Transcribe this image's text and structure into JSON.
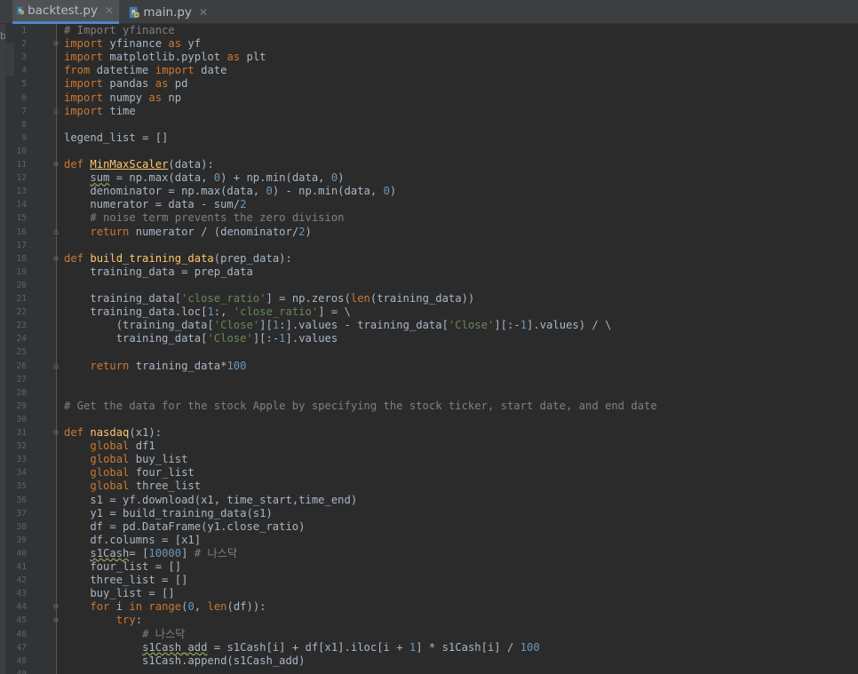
{
  "tabs": [
    {
      "label": "backtest.py",
      "active": true
    },
    {
      "label": "main.py",
      "active": false
    }
  ],
  "left_edge_glyph": "b",
  "icon": "python-file-icon",
  "colors": {
    "background": "#2b2b2b",
    "keyword": "#cc7832",
    "comment": "#808080",
    "string": "#6a8759",
    "number": "#6897bb",
    "function": "#ffc66d",
    "text": "#a9b7c6",
    "tab_accent": "#4a88c7"
  },
  "editor": {
    "lines": [
      {
        "n": "1",
        "fold": "",
        "t": [
          [
            "cm",
            "# Import yfinance"
          ]
        ]
      },
      {
        "n": "2",
        "fold": "open",
        "t": [
          [
            "kw",
            "import"
          ],
          [
            "",
            " yfinance "
          ],
          [
            "kw",
            "as"
          ],
          [
            "",
            " yf"
          ]
        ]
      },
      {
        "n": "3",
        "fold": "",
        "t": [
          [
            "kw",
            "import"
          ],
          [
            "",
            " matplotlib.pyplot "
          ],
          [
            "kw",
            "as"
          ],
          [
            "",
            " plt"
          ]
        ]
      },
      {
        "n": "4",
        "fold": "",
        "t": [
          [
            "kw",
            "from"
          ],
          [
            "",
            " datetime "
          ],
          [
            "kw",
            "import"
          ],
          [
            "",
            " date"
          ]
        ]
      },
      {
        "n": "5",
        "fold": "",
        "t": [
          [
            "kw",
            "import"
          ],
          [
            "",
            " pandas "
          ],
          [
            "kw",
            "as"
          ],
          [
            "",
            " pd"
          ]
        ]
      },
      {
        "n": "6",
        "fold": "",
        "t": [
          [
            "kw",
            "import"
          ],
          [
            "",
            " numpy "
          ],
          [
            "kw",
            "as"
          ],
          [
            "",
            " np"
          ]
        ]
      },
      {
        "n": "7",
        "fold": "close",
        "t": [
          [
            "kw",
            "import"
          ],
          [
            "",
            " time"
          ]
        ]
      },
      {
        "n": "8",
        "fold": "",
        "t": []
      },
      {
        "n": "9",
        "fold": "",
        "t": [
          [
            "",
            "legend_list = []"
          ]
        ]
      },
      {
        "n": "10",
        "fold": "",
        "t": []
      },
      {
        "n": "11",
        "fold": "open",
        "t": [
          [
            "kw",
            "def "
          ],
          [
            "fnu",
            "MinMaxScaler"
          ],
          [
            "",
            "(data):"
          ]
        ]
      },
      {
        "n": "12",
        "fold": "",
        "t": [
          [
            "",
            "    "
          ],
          [
            "sq",
            "sum"
          ],
          [
            "",
            " = np.max(data, "
          ],
          [
            "nu",
            "0"
          ],
          [
            "",
            ") + np.min(data, "
          ],
          [
            "nu",
            "0"
          ],
          [
            "",
            ")"
          ]
        ]
      },
      {
        "n": "13",
        "fold": "",
        "t": [
          [
            "",
            "    denominator = np.max(data, "
          ],
          [
            "nu",
            "0"
          ],
          [
            "",
            ") - np.min(data, "
          ],
          [
            "nu",
            "0"
          ],
          [
            "",
            ")"
          ]
        ]
      },
      {
        "n": "14",
        "fold": "",
        "t": [
          [
            "",
            "    numerator = data - sum/"
          ],
          [
            "nu",
            "2"
          ]
        ]
      },
      {
        "n": "15",
        "fold": "",
        "t": [
          [
            "",
            "    "
          ],
          [
            "cm",
            "# noise term prevents the zero division"
          ]
        ]
      },
      {
        "n": "16",
        "fold": "close",
        "t": [
          [
            "",
            "    "
          ],
          [
            "kw",
            "return"
          ],
          [
            "",
            " numerator / (denominator/"
          ],
          [
            "nu",
            "2"
          ],
          [
            "",
            ")"
          ]
        ]
      },
      {
        "n": "17",
        "fold": "",
        "t": []
      },
      {
        "n": "18",
        "fold": "open",
        "t": [
          [
            "kw",
            "def "
          ],
          [
            "fn",
            "build_training_data"
          ],
          [
            "",
            "(prep_data):"
          ]
        ]
      },
      {
        "n": "19",
        "fold": "",
        "t": [
          [
            "",
            "    training_data = prep_data"
          ]
        ]
      },
      {
        "n": "20",
        "fold": "",
        "t": []
      },
      {
        "n": "21",
        "fold": "",
        "t": [
          [
            "",
            "    training_data["
          ],
          [
            "st",
            "'close_ratio'"
          ],
          [
            "",
            "] = np.zeros("
          ],
          [
            "kw",
            "len"
          ],
          [
            "",
            "(training_data))"
          ]
        ]
      },
      {
        "n": "22",
        "fold": "",
        "t": [
          [
            "",
            "    training_data.loc["
          ],
          [
            "nu",
            "1"
          ],
          [
            "",
            ":, "
          ],
          [
            "st",
            "'close_ratio'"
          ],
          [
            "",
            "] = \\"
          ]
        ]
      },
      {
        "n": "23",
        "fold": "",
        "t": [
          [
            "",
            "        (training_data["
          ],
          [
            "st",
            "'Close'"
          ],
          [
            "",
            "]["
          ],
          [
            "nu",
            "1"
          ],
          [
            "",
            ":].values - training_data["
          ],
          [
            "st",
            "'Close'"
          ],
          [
            "",
            "][:-"
          ],
          [
            "nu",
            "1"
          ],
          [
            "",
            "].values) / \\"
          ]
        ]
      },
      {
        "n": "24",
        "fold": "",
        "t": [
          [
            "",
            "        training_data["
          ],
          [
            "st",
            "'Close'"
          ],
          [
            "",
            "][:-"
          ],
          [
            "nu",
            "1"
          ],
          [
            "",
            "].values"
          ]
        ]
      },
      {
        "n": "25",
        "fold": "",
        "t": []
      },
      {
        "n": "26",
        "fold": "close",
        "t": [
          [
            "",
            "    "
          ],
          [
            "kw",
            "return"
          ],
          [
            "",
            " training_data*"
          ],
          [
            "nu",
            "100"
          ]
        ]
      },
      {
        "n": "27",
        "fold": "",
        "t": []
      },
      {
        "n": "28",
        "fold": "",
        "t": []
      },
      {
        "n": "29",
        "fold": "",
        "t": [
          [
            "cm",
            "# Get the data for the stock Apple by specifying the stock ticker, start date, and end date"
          ]
        ]
      },
      {
        "n": "30",
        "fold": "",
        "t": []
      },
      {
        "n": "31",
        "fold": "open",
        "t": [
          [
            "kw",
            "def "
          ],
          [
            "fn",
            "nasdaq"
          ],
          [
            "",
            "(x1):"
          ]
        ]
      },
      {
        "n": "32",
        "fold": "",
        "t": [
          [
            "",
            "    "
          ],
          [
            "kw",
            "global"
          ],
          [
            "",
            " df1"
          ]
        ]
      },
      {
        "n": "33",
        "fold": "",
        "t": [
          [
            "",
            "    "
          ],
          [
            "kw",
            "global"
          ],
          [
            "",
            " buy_list"
          ]
        ]
      },
      {
        "n": "34",
        "fold": "",
        "t": [
          [
            "",
            "    "
          ],
          [
            "kw",
            "global"
          ],
          [
            "",
            " four_list"
          ]
        ]
      },
      {
        "n": "35",
        "fold": "",
        "t": [
          [
            "",
            "    "
          ],
          [
            "kw",
            "global"
          ],
          [
            "",
            " three_list"
          ]
        ]
      },
      {
        "n": "36",
        "fold": "",
        "t": [
          [
            "",
            "    s1 = yf.download(x1, time_start,time_end)"
          ]
        ]
      },
      {
        "n": "37",
        "fold": "",
        "t": [
          [
            "",
            "    y1 = build_training_data(s1)"
          ]
        ]
      },
      {
        "n": "38",
        "fold": "",
        "t": [
          [
            "",
            "    df = pd.DataFrame(y1.close_ratio)"
          ]
        ]
      },
      {
        "n": "39",
        "fold": "",
        "t": [
          [
            "",
            "    df.columns = [x1]"
          ]
        ]
      },
      {
        "n": "40",
        "fold": "",
        "t": [
          [
            "",
            "    "
          ],
          [
            "sq",
            "s1Cash"
          ],
          [
            "",
            "= ["
          ],
          [
            "nu",
            "10000"
          ],
          [
            "",
            "] "
          ],
          [
            "cm",
            "# 나스닥"
          ]
        ]
      },
      {
        "n": "41",
        "fold": "",
        "t": [
          [
            "",
            "    four_list = []"
          ]
        ]
      },
      {
        "n": "42",
        "fold": "",
        "t": [
          [
            "",
            "    three_list = []"
          ]
        ]
      },
      {
        "n": "43",
        "fold": "",
        "t": [
          [
            "",
            "    buy_list = []"
          ]
        ]
      },
      {
        "n": "44",
        "fold": "open",
        "t": [
          [
            "",
            "    "
          ],
          [
            "kw",
            "for"
          ],
          [
            "",
            " i "
          ],
          [
            "kw",
            "in"
          ],
          [
            "",
            " "
          ],
          [
            "kw",
            "range"
          ],
          [
            "",
            "("
          ],
          [
            "nu",
            "0"
          ],
          [
            "",
            ", "
          ],
          [
            "kw",
            "len"
          ],
          [
            "",
            "(df)):"
          ]
        ]
      },
      {
        "n": "45",
        "fold": "open",
        "t": [
          [
            "",
            "        "
          ],
          [
            "kw",
            "try"
          ],
          [
            "",
            ":"
          ]
        ]
      },
      {
        "n": "46",
        "fold": "",
        "t": [
          [
            "",
            "            "
          ],
          [
            "cm",
            "# 나스닥"
          ]
        ]
      },
      {
        "n": "47",
        "fold": "",
        "t": [
          [
            "",
            "            "
          ],
          [
            "sq",
            "s1Cash_add"
          ],
          [
            "",
            " = s1Cash[i] + df[x1].iloc[i + "
          ],
          [
            "nu",
            "1"
          ],
          [
            "",
            "] * s1Cash[i] / "
          ],
          [
            "nu",
            "100"
          ]
        ]
      },
      {
        "n": "48",
        "fold": "",
        "t": [
          [
            "",
            "            s1Cash.append(s1Cash_add)"
          ]
        ]
      },
      {
        "n": "49",
        "fold": "",
        "t": []
      }
    ]
  }
}
